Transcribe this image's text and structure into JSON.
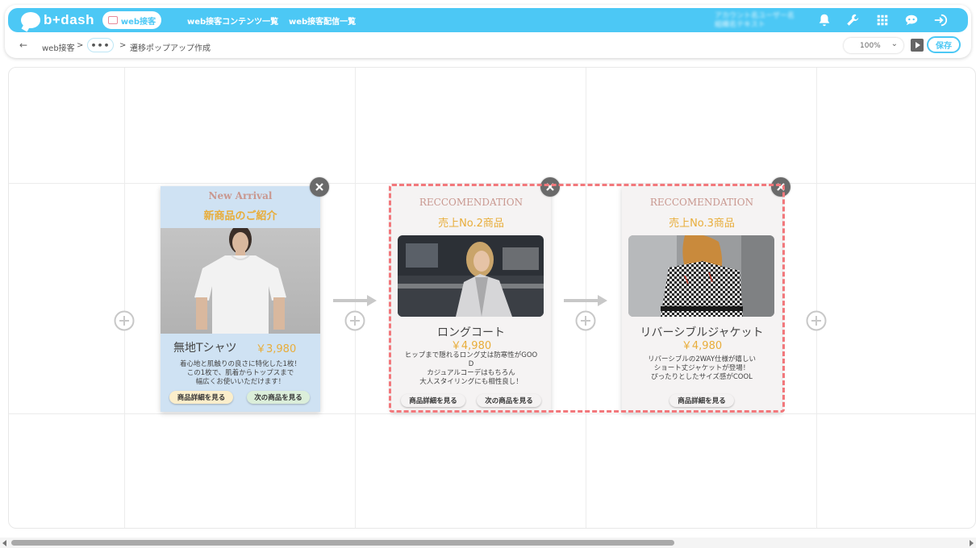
{
  "app": {
    "logo_text": "b+dash"
  },
  "nav": {
    "active_label": "web接客",
    "links": [
      "web接客コンテンツ一覧",
      "web接客配信一覧"
    ],
    "user_line1": "アカウント名ユーザー名",
    "user_line2": "組織名テキスト",
    "icons": [
      "bell-icon",
      "wrench-icon",
      "grid-icon",
      "chat-bot-icon",
      "logout-icon"
    ]
  },
  "breadcrumb": {
    "back": "←",
    "root": "web接客",
    "sep1": ">",
    "ellipsis": "•••",
    "sep2": ">",
    "current": "遷移ポップアップ作成"
  },
  "toolbar": {
    "zoom": "100%",
    "save_label": "保存"
  },
  "popups": [
    {
      "eyebrow": "New Arrival",
      "title": "新商品のご紹介",
      "name": "無地Tシャツ",
      "price": "￥3,980",
      "desc": [
        "着心地と肌触りの良さに特化した1枚！",
        "この1枚で、肌着からトップスまで",
        "幅広くお使いいただけます！"
      ],
      "btn1": "商品詳細を見る",
      "btn2": "次の商品を見る"
    },
    {
      "eyebrow": "RECCOMENDATION",
      "title": "売上No.2商品",
      "name": "ロングコート",
      "price": "￥4,980",
      "desc": [
        "ヒップまで隠れるロング丈は防寒性がGOO",
        "D",
        "カジュアルコーデはもちろん",
        "大人スタイリングにも相性良し！"
      ],
      "btn1": "商品詳細を見る",
      "btn2": "次の商品を見る"
    },
    {
      "eyebrow": "RECCOMENDATION",
      "title": "売上No.3商品",
      "name": "リバーシブルジャケット",
      "price": "￥4,980",
      "desc": [
        "リバーシブルの2WAY仕様が嬉しい",
        "ショート丈ジャケットが登場！",
        "ぴったりとしたサイズ感がCOOL"
      ],
      "btn1": "商品詳細を見る"
    }
  ],
  "colors": {
    "nav_bg": "#4cc8f5",
    "accent_gold": "#e8ad3a",
    "selection": "#f2787c",
    "eyebrow": "#c99890"
  }
}
